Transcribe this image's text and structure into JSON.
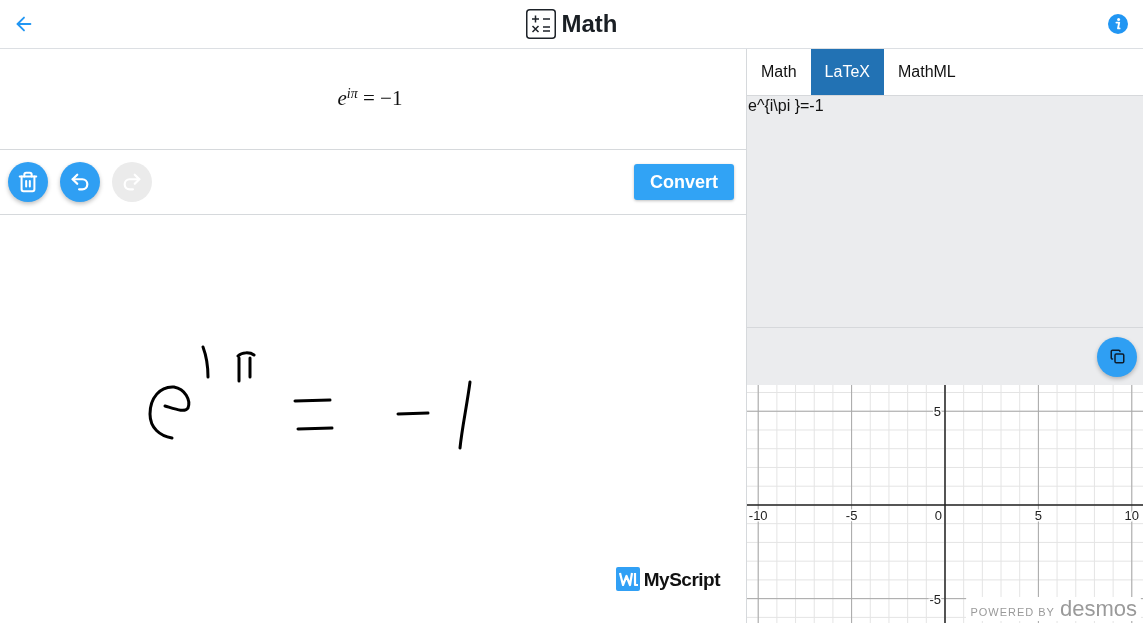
{
  "header": {
    "title": "Math"
  },
  "editor": {
    "result": "*e*$^{iπ}$ = −1",
    "tools": [
      {
        "kind": "clear",
        "disabled": false
      },
      {
        "kind": "undo",
        "disabled": false
      },
      {
        "kind": "redo",
        "disabled": true
      }
    ],
    "convert_button": "Convert",
    "brand": "MyScript"
  },
  "output": {
    "tabs": [
      {
        "label": "Math",
        "selected": false
      },
      {
        "label": "LaTeX",
        "selected": true
      },
      {
        "label": "MathML",
        "selected": false
      }
    ],
    "latex": "e^{i\\pi }=-1"
  },
  "graph": {
    "chart_data": {
      "type": "line",
      "xlim": [
        -10.6,
        10.6
      ],
      "ylim": [
        -6.3,
        6.4
      ],
      "xticks": [
        -10,
        -5,
        0,
        5,
        10
      ],
      "yticks": [
        -5,
        5
      ],
      "grid": true
    },
    "attribution": "POWERED BY",
    "attribution_logo": "desmos"
  }
}
